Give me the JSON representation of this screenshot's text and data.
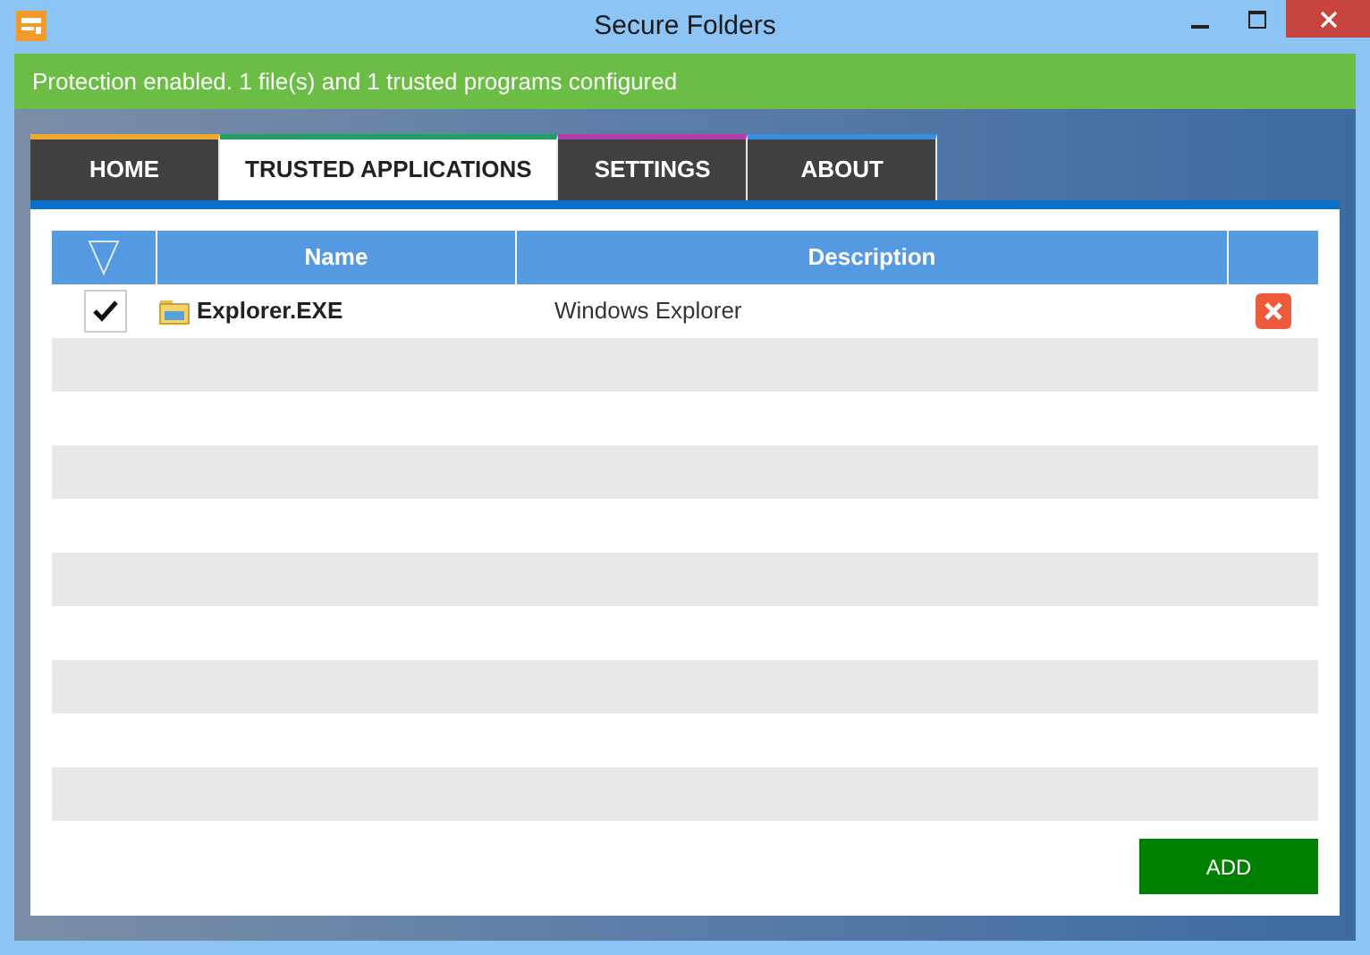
{
  "window": {
    "title": "Secure Folders"
  },
  "status_banner": "Protection enabled. 1 file(s) and 1 trusted programs configured",
  "tabs": [
    {
      "label": "HOME",
      "selected": false,
      "color": "#f0a830"
    },
    {
      "label": "TRUSTED APPLICATIONS",
      "selected": true,
      "color": "#1fa060"
    },
    {
      "label": "SETTINGS",
      "selected": false,
      "color": "#b040a8"
    },
    {
      "label": "ABOUT",
      "selected": false,
      "color": "#3a8ee0"
    }
  ],
  "table": {
    "columns": [
      "Name",
      "Description"
    ],
    "rows": [
      {
        "checked": true,
        "name": "Explorer.EXE",
        "description": "Windows Explorer"
      }
    ]
  },
  "add_button": "ADD"
}
